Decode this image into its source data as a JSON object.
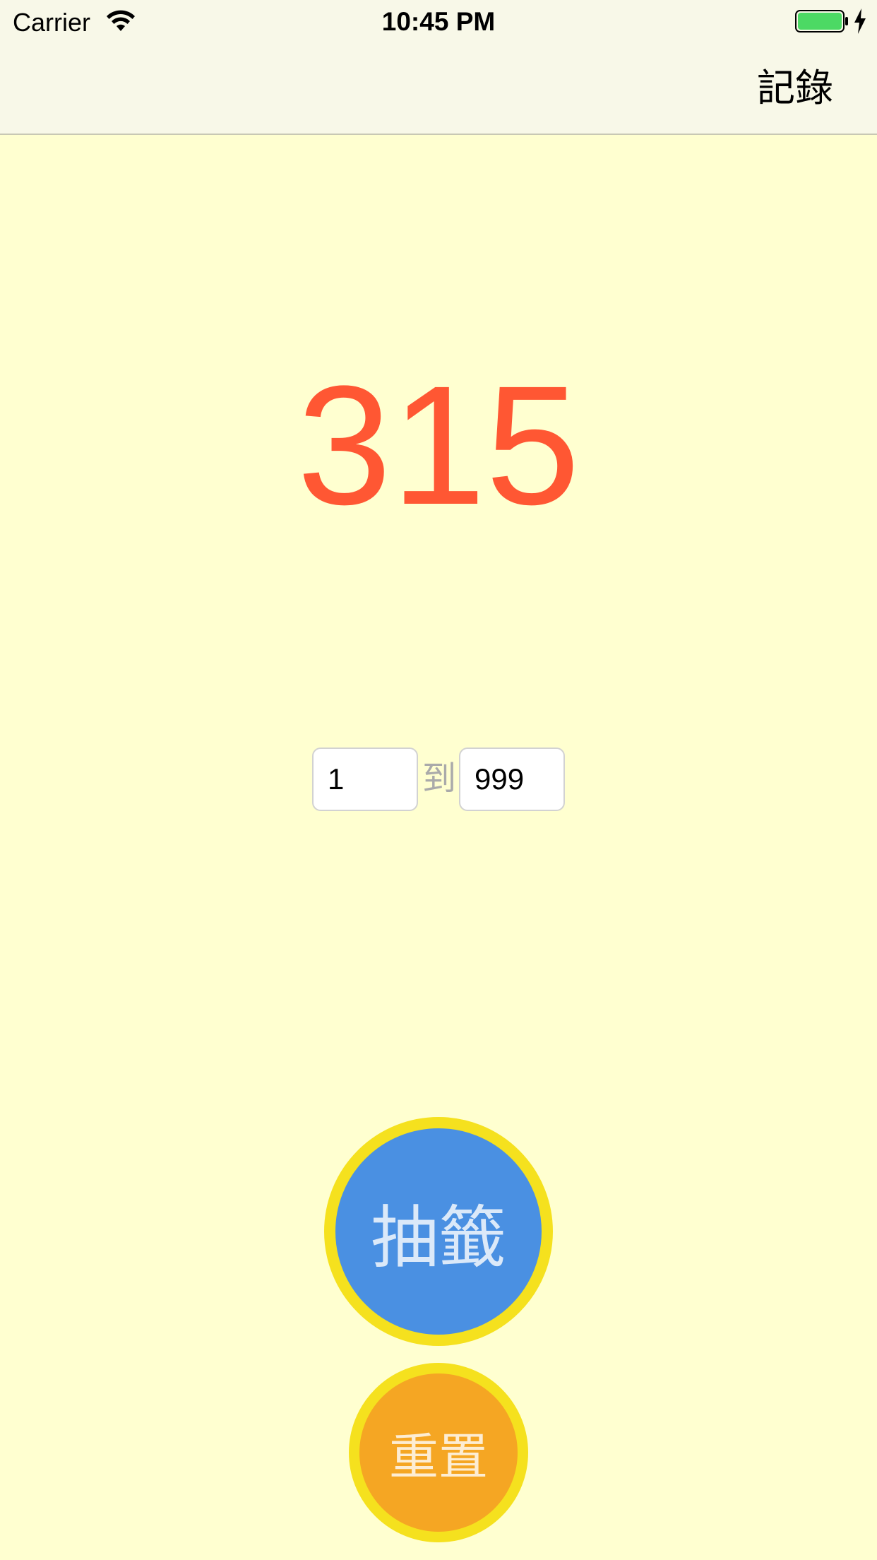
{
  "status_bar": {
    "carrier": "Carrier",
    "time": "10:45 PM",
    "icons": [
      "wifi-icon",
      "battery-icon",
      "charging-bolt-icon"
    ],
    "battery_color": "#4CD964"
  },
  "nav": {
    "records_label": "記錄"
  },
  "result": {
    "value": "315",
    "color": "#FF5733"
  },
  "range": {
    "min_value": "1",
    "to_label": "到",
    "max_value": "999"
  },
  "buttons": {
    "draw_label": "抽籤",
    "reset_label": "重置"
  },
  "colors": {
    "background": "#FFFFD0",
    "draw_button": "#4A90E2",
    "reset_button": "#F5A623",
    "button_ring": "#F5E11E"
  }
}
